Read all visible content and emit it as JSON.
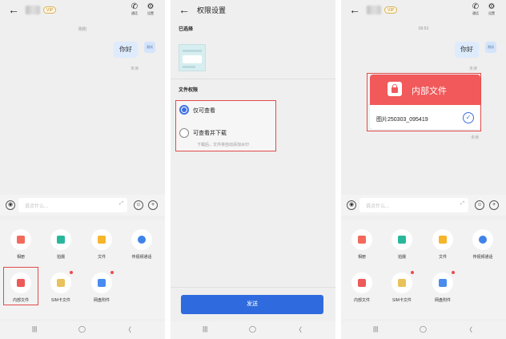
{
  "screens": [
    {
      "header": {
        "back": "←",
        "vip": "VIP",
        "call_label": "通话",
        "settings_label": "设置"
      },
      "time": "刚刚",
      "message": {
        "text": "你好",
        "avatar": "测试",
        "status": "未读"
      },
      "input": {
        "placeholder": "说点什么...",
        "expand": "⤢",
        "voice": "◉",
        "emoji": "☺",
        "add": "+"
      },
      "tray": [
        {
          "label": "相册",
          "color": "#f26a5c",
          "badge": false
        },
        {
          "label": "拍摄",
          "color": "#28b79a",
          "badge": false
        },
        {
          "label": "文件",
          "color": "#f6b52b",
          "badge": false
        },
        {
          "label": "传视频通话",
          "color": "#3f83ea",
          "badge": false
        },
        {
          "label": "内部文件",
          "color": "#ec5a5a",
          "badge": false
        },
        {
          "label": "SIM卡文件",
          "color": "#e9c25b",
          "badge": true
        },
        {
          "label": "网盘附件",
          "color": "#4a8bf0",
          "badge": true
        }
      ],
      "nav": {
        "recent": "|||",
        "home": "◯",
        "back": "〈"
      }
    },
    {
      "header": {
        "back": "←",
        "title": "权限设置"
      },
      "selected_label": "已选择",
      "permission_label": "文件权限",
      "options": [
        {
          "label": "仅可查看",
          "selected": true
        },
        {
          "label": "可查看并下载",
          "selected": false,
          "hint": "下载后，文件将自动添加水印"
        }
      ],
      "send": "发送",
      "nav": {
        "recent": "|||",
        "home": "◯",
        "back": "〈"
      }
    },
    {
      "header": {
        "back": "←",
        "vip": "VIP",
        "call_label": "通话",
        "settings_label": "设置"
      },
      "time": "09:53",
      "message": {
        "text": "你好",
        "avatar": "测试",
        "status": "未读"
      },
      "card": {
        "title": "内部文件",
        "filename": "图片250303_095419",
        "status": "未读",
        "check": "✓"
      },
      "input": {
        "placeholder": "说点什么...",
        "expand": "⤢",
        "voice": "◉",
        "emoji": "☺",
        "add": "+"
      },
      "tray": [
        {
          "label": "相册",
          "color": "#f26a5c",
          "badge": false
        },
        {
          "label": "拍摄",
          "color": "#28b79a",
          "badge": false
        },
        {
          "label": "文件",
          "color": "#f6b52b",
          "badge": false
        },
        {
          "label": "传视频通话",
          "color": "#3f83ea",
          "badge": false
        },
        {
          "label": "内部文件",
          "color": "#ec5a5a",
          "badge": false
        },
        {
          "label": "SIM卡文件",
          "color": "#e9c25b",
          "badge": true
        },
        {
          "label": "网盘附件",
          "color": "#4a8bf0",
          "badge": true
        }
      ],
      "nav": {
        "recent": "|||",
        "home": "◯",
        "back": "〈"
      }
    }
  ]
}
